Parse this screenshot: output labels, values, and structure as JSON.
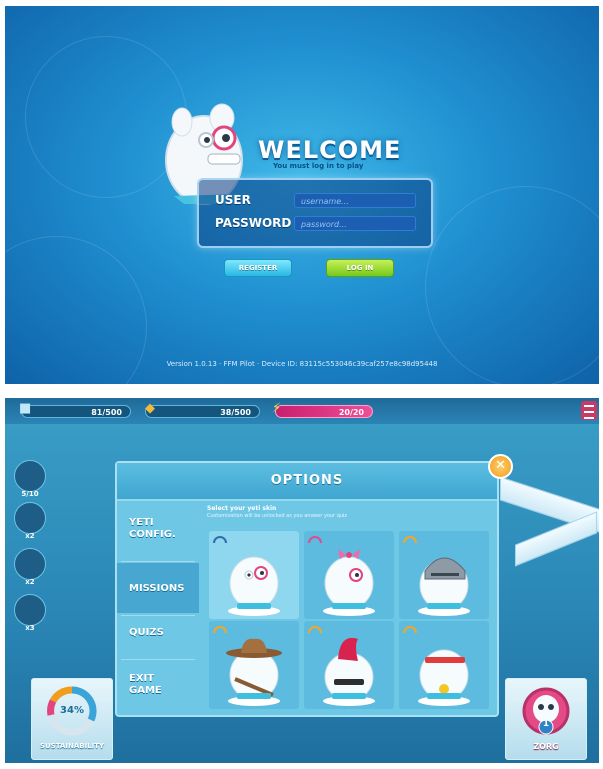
{
  "login": {
    "title": "WELCOME",
    "subtitle": "You must log in to play",
    "user_label": "USER",
    "user_placeholder": "username...",
    "password_label": "PASSWORD",
    "password_placeholder": "password...",
    "register_label": "REGISTER",
    "login_label": "LOG IN",
    "version_text": "Version 1.0.13 · FFM Pilot · Device ID: 83115c553046c39caf257e8c98d95448"
  },
  "game": {
    "stats": [
      {
        "value": "81/500",
        "icon": "ice-cube-icon"
      },
      {
        "value": "38/500",
        "icon": "fish-icon"
      },
      {
        "value": "20/20",
        "icon": "lightning-icon"
      }
    ],
    "avatars": [
      {
        "name": "penguin-avatar",
        "count": "5/10"
      },
      {
        "name": "seal-avatar",
        "count": "x2"
      },
      {
        "name": "seal-dark-avatar",
        "count": "x2"
      },
      {
        "name": "orca-avatar",
        "count": "x3"
      }
    ],
    "options": {
      "title": "OPTIONS",
      "menu": [
        "YETI CONFIG.",
        "MISSIONS",
        "QUIZS",
        "EXIT GAME"
      ],
      "skins_title": "Select your yeti skin",
      "skins_subtitle": "Customization will be unlocked as you answer your quiz",
      "close_label": "✕"
    },
    "sustainability_pct": "34%",
    "sustainability_label": "SUSTAINABILITY",
    "zorg_level": "1",
    "zorg_label": "ZORG"
  },
  "colors": {
    "accent": "#2b9fd6",
    "energy": "#e8447f",
    "login_btn": "#7ccf1f",
    "register_btn": "#3ec4ee",
    "close_btn": "#f5a623"
  }
}
